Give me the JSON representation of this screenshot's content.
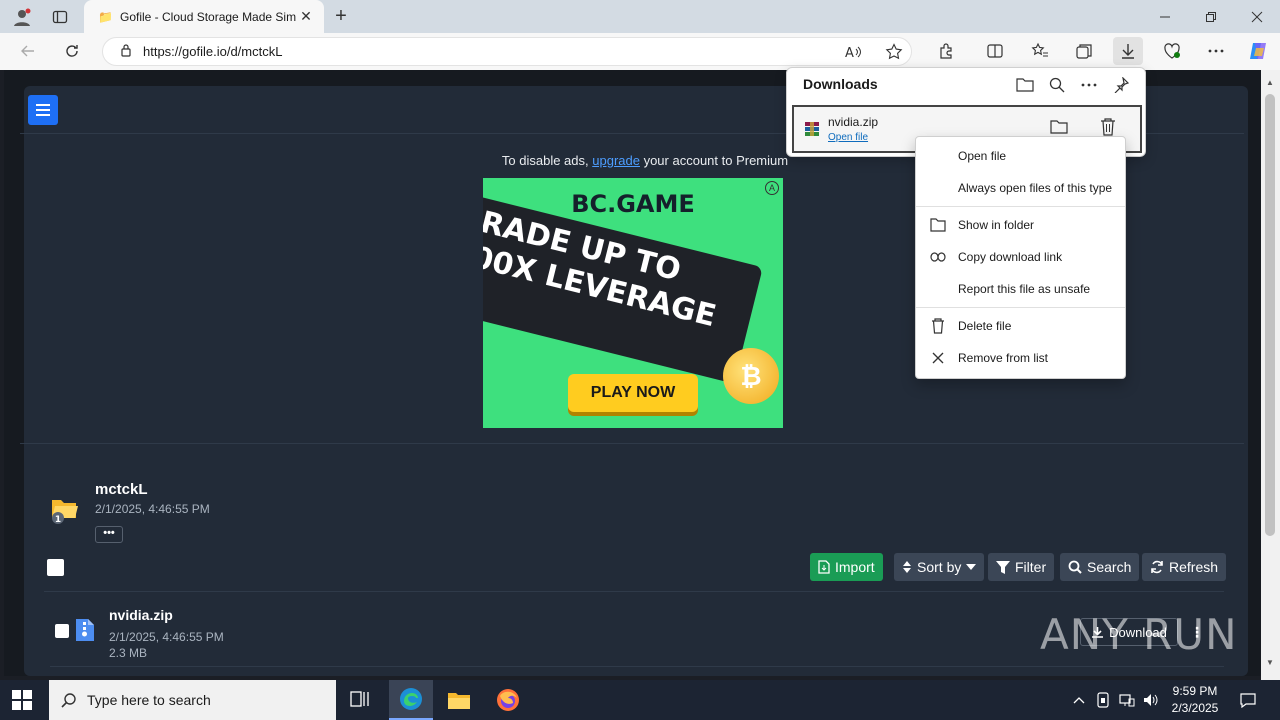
{
  "browser": {
    "tab_title": "Gofile - Cloud Storage Made Sim",
    "url": "https://gofile.io/d/mctckL"
  },
  "page": {
    "ads_prefix": "To disable ads, ",
    "ads_link": "upgrade",
    "ads_suffix": " your account to Premium",
    "ad": {
      "logo": "BC.GAME",
      "headline_1": "RADE UP TO",
      "headline_2": "00X LEVERAGE",
      "cta": "PLAY NOW"
    },
    "folder": {
      "name": "mctckL",
      "date": "2/1/2025, 4:46:55 PM",
      "badge": "1",
      "more": "•••"
    },
    "actions": {
      "import": "Import",
      "sort": "Sort by",
      "filter": "Filter",
      "search": "Search",
      "refresh": "Refresh"
    },
    "file": {
      "name": "nvidia.zip",
      "date": "2/1/2025, 4:46:55 PM",
      "size": "2.3 MB",
      "download": "Download"
    },
    "watermark": "ANY RUN"
  },
  "downloads": {
    "title": "Downloads",
    "item": {
      "name": "nvidia.zip",
      "action": "Open file"
    }
  },
  "context_menu": {
    "open_file": "Open file",
    "always_open": "Always open files of this type",
    "show_in_folder": "Show in folder",
    "copy_link": "Copy download link",
    "report_unsafe": "Report this file as unsafe",
    "delete_file": "Delete file",
    "remove_from_list": "Remove from list"
  },
  "taskbar": {
    "search_placeholder": "Type here to search",
    "time": "9:59 PM",
    "date": "2/3/2025"
  },
  "colors": {
    "accent_blue": "#1e6ff5",
    "import_green": "#1a9c55",
    "page_bg": "#222b38"
  }
}
